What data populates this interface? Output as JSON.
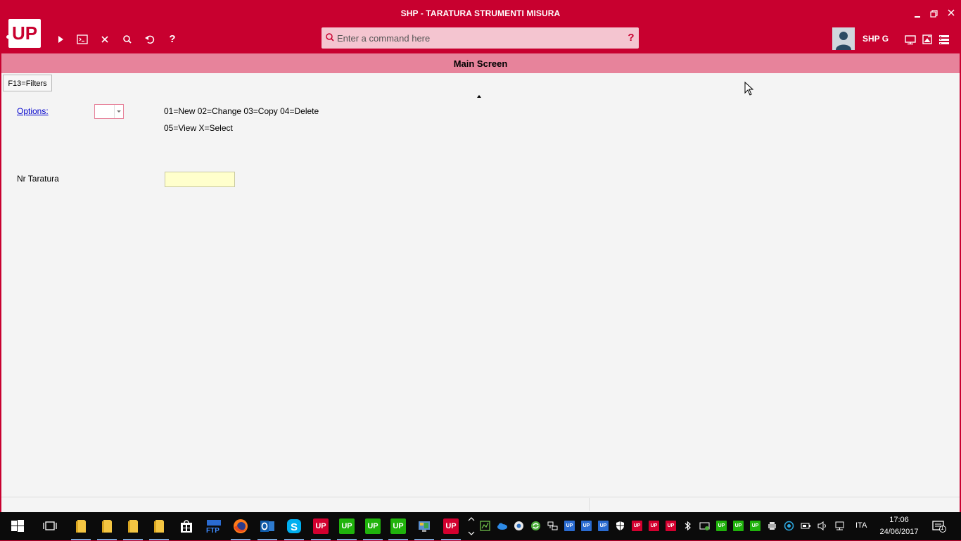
{
  "window": {
    "title": "SHP - TARATURA STRUMENTI MISURA",
    "controls": [
      "minimize-icon",
      "restore-icon",
      "close-icon"
    ]
  },
  "toolbar": {
    "logo_text": "UP",
    "icons": [
      "play-icon",
      "terminal-icon",
      "close-icon",
      "search-icon",
      "undo-icon",
      "help-icon"
    ],
    "command_placeholder": "Enter a command here",
    "command_help": "?",
    "user_name": "SHP G",
    "right_icons": [
      "monitor-icon",
      "image-edit-icon",
      "server-list-icon"
    ]
  },
  "screen": {
    "header": "Main Screen",
    "filters_button": "F13=Filters",
    "options_label": "Options:",
    "options_value": "",
    "options_help_line1": "01=New 02=Change 03=Copy 04=Delete",
    "options_help_line2": "05=View X=Select",
    "nr_taratura_label": "Nr Taratura",
    "nr_taratura_value": ""
  },
  "taskbar": {
    "apps": [
      "windows-start-icon",
      "task-view-icon",
      "folder-icon",
      "folder-icon",
      "folder-icon",
      "folder-icon",
      "store-icon",
      "ftp-icon",
      "firefox-icon",
      "outlook-icon",
      "skype-icon",
      "up-red",
      "up-green",
      "up-green",
      "up-green",
      "app-icon",
      "up-red"
    ],
    "app_up_label": "UP",
    "ftp_label": "FTP",
    "language": "ITA",
    "time": "17:06",
    "date": "24/06/2017",
    "notifications_count": "1"
  },
  "colors": {
    "brand": "#c8002f",
    "header": "#e7839b",
    "command_bar": "#f4c5d0",
    "input_bg": "#ffffcc",
    "up_green": "#20b30c"
  }
}
